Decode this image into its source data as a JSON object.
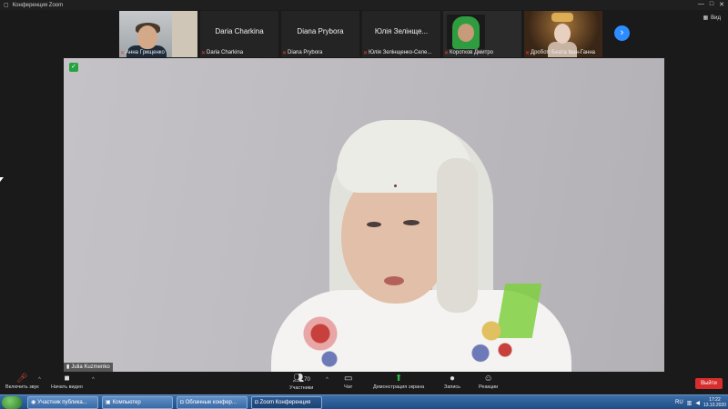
{
  "titlebar": {
    "title": "Конференция Zoom",
    "minimize": "—",
    "maximize": "□",
    "close": "✕"
  },
  "view_toggle": {
    "label": "Вид"
  },
  "participants": [
    {
      "name": "Анна Грищенко",
      "muted": true,
      "video": true
    },
    {
      "name": "Daria Charkina",
      "label": "Daria Charkina",
      "muted": true,
      "video": false
    },
    {
      "name": "Diana Prybora",
      "label": "Diana Prybora",
      "muted": true,
      "video": false
    },
    {
      "name": "Юлія Зелінщенко",
      "display": "Юлія Зелінще...",
      "label": "Юлія Зелінщенко-Селе...",
      "muted": true,
      "video": false
    },
    {
      "name": "Коротков Дмитро",
      "muted": true,
      "video": true
    },
    {
      "name": "Дроботі Беата Іван-Ганна",
      "muted": true,
      "video": true
    }
  ],
  "main_speaker": {
    "name": "Julia Kuzmenko"
  },
  "toolbar": {
    "mute": "Включить звук",
    "video": "Начать видео",
    "participants": "Участники",
    "participants_count": "70",
    "chat": "Чат",
    "share": "Демонстрация экрана",
    "record": "Запись",
    "reactions": "Реакции",
    "end": "Выйти"
  },
  "taskbar": {
    "tasks": [
      {
        "label": "Участник публика...",
        "active": false
      },
      {
        "label": "Компьютер",
        "active": false
      },
      {
        "label": "Облачные конфер...",
        "active": false
      },
      {
        "label": "Zoom Конференция",
        "active": true
      }
    ],
    "lang": "RU",
    "time": "17:22",
    "date": "13.10.2020"
  },
  "colors": {
    "accent": "#2d8cff",
    "end_button": "#d82d2d",
    "muted_mic": "#e0463b",
    "security_shield": "#23a33f"
  }
}
